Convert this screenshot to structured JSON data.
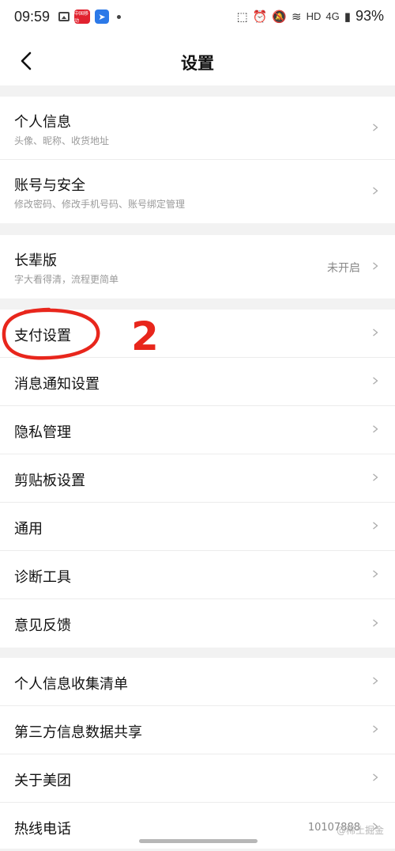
{
  "status_bar": {
    "time": "09:59",
    "app_red_label": "中国移动",
    "network": "HD",
    "signal": "4G",
    "battery": "93%"
  },
  "nav": {
    "title": "设置"
  },
  "groups": [
    {
      "items": [
        {
          "title": "个人信息",
          "subtitle": "头像、昵称、收货地址"
        },
        {
          "title": "账号与安全",
          "subtitle": "修改密码、修改手机号码、账号绑定管理"
        }
      ]
    },
    {
      "items": [
        {
          "title": "长辈版",
          "subtitle": "字大看得清，流程更简单",
          "value": "未开启"
        }
      ]
    },
    {
      "items": [
        {
          "title": "支付设置"
        },
        {
          "title": "消息通知设置"
        },
        {
          "title": "隐私管理"
        },
        {
          "title": "剪贴板设置"
        },
        {
          "title": "通用"
        },
        {
          "title": "诊断工具"
        },
        {
          "title": "意见反馈"
        }
      ]
    },
    {
      "items": [
        {
          "title": "个人信息收集清单"
        },
        {
          "title": "第三方信息数据共享"
        },
        {
          "title": "关于美团"
        },
        {
          "title": "热线电话",
          "value": "10107888"
        }
      ]
    }
  ],
  "annotation": {
    "number": "2",
    "color": "#e8261c"
  },
  "watermark": "@稀土掘金"
}
